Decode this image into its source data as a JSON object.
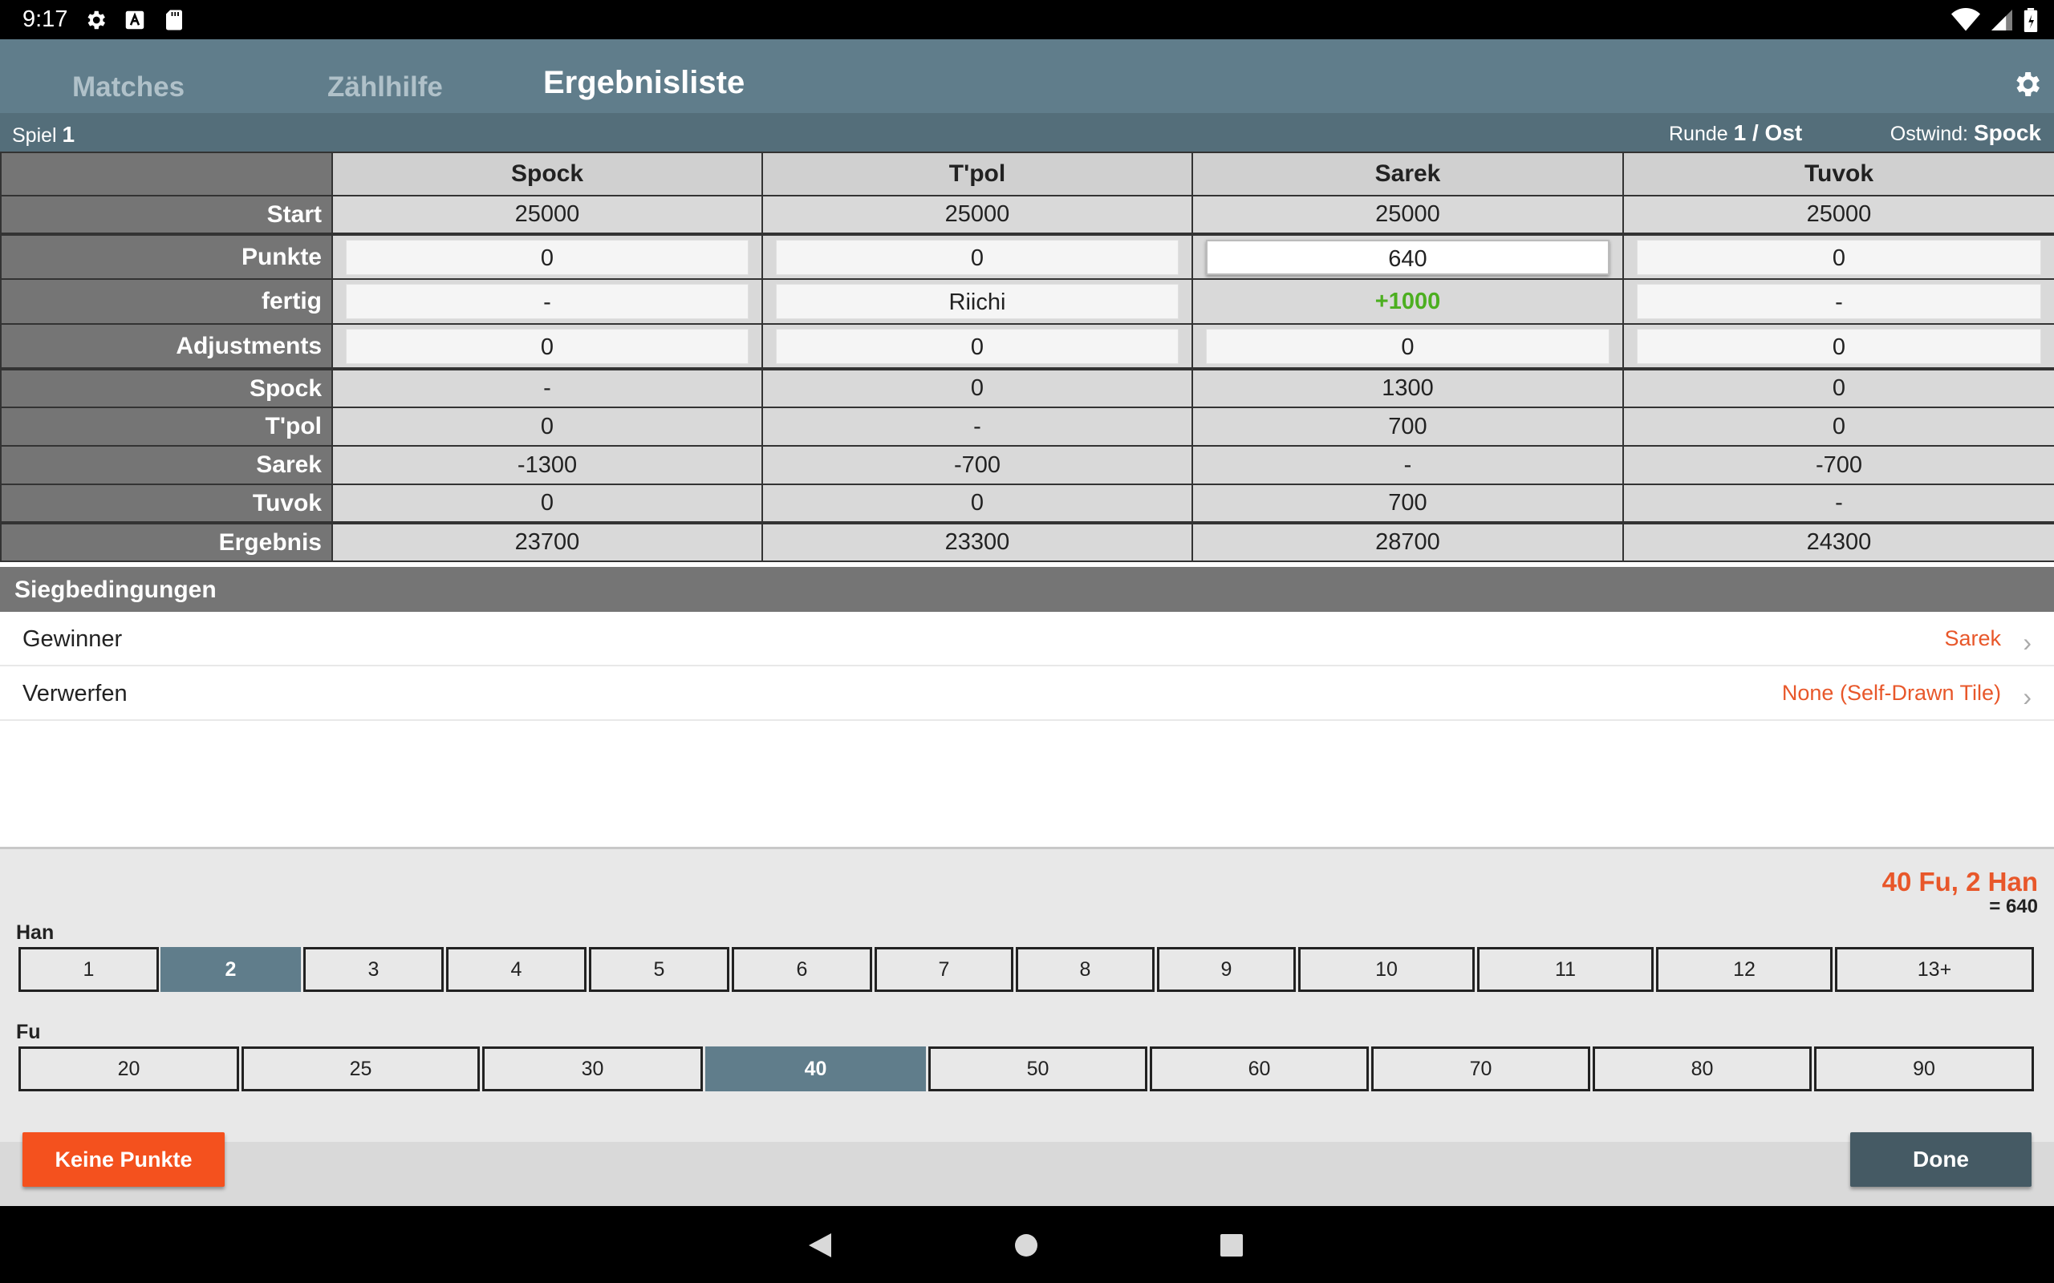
{
  "status": {
    "time": "9:17"
  },
  "tabs": [
    {
      "label": "Matches"
    },
    {
      "label": "Zählhilfe"
    },
    {
      "label": "Ergebnisliste"
    }
  ],
  "info": {
    "spiel_label": "Spiel",
    "spiel_value": "1",
    "runde_label": "Runde",
    "runde_value": "1 / Ost",
    "ostwind_label": "Ostwind:",
    "ostwind_value": "Spock"
  },
  "table": {
    "players": [
      "Spock",
      "T'pol",
      "Sarek",
      "Tuvok"
    ],
    "start": {
      "label": "Start",
      "values": [
        "25000",
        "25000",
        "25000",
        "25000"
      ]
    },
    "punkte": {
      "label": "Punkte",
      "values": [
        "0",
        "0",
        "640",
        "0"
      ]
    },
    "fertig": {
      "label": "fertig",
      "values": [
        "-",
        "Riichi",
        "+1000",
        "-"
      ]
    },
    "adjustments": {
      "label": "Adjustments",
      "values": [
        "0",
        "0",
        "0",
        "0"
      ]
    },
    "transfers": [
      {
        "label": "Spock",
        "values": [
          "-",
          "0",
          "1300",
          "0"
        ]
      },
      {
        "label": "T'pol",
        "values": [
          "0",
          "-",
          "700",
          "0"
        ]
      },
      {
        "label": "Sarek",
        "values": [
          "-1300",
          "-700",
          "-",
          "-700"
        ]
      },
      {
        "label": "Tuvok",
        "values": [
          "0",
          "0",
          "700",
          "-"
        ]
      }
    ],
    "ergebnis": {
      "label": "Ergebnis",
      "values": [
        "23700",
        "23300",
        "28700",
        "24300"
      ]
    }
  },
  "sieg": {
    "header": "Siegbedingungen",
    "gewinner_label": "Gewinner",
    "gewinner_value": "Sarek",
    "verwerfen_label": "Verwerfen",
    "verwerfen_value": "None (Self-Drawn Tile)"
  },
  "scoring": {
    "result": "40 Fu, 2 Han",
    "result_sub": "= 640",
    "han_label": "Han",
    "han_options": [
      "1",
      "2",
      "3",
      "4",
      "5",
      "6",
      "7",
      "8",
      "9",
      "10",
      "11",
      "12",
      "13+"
    ],
    "han_selected": "2",
    "fu_label": "Fu",
    "fu_options": [
      "20",
      "25",
      "30",
      "40",
      "50",
      "60",
      "70",
      "80",
      "90"
    ],
    "fu_selected": "40"
  },
  "buttons": {
    "none_label": "Keine Punkte",
    "done_label": "Done"
  },
  "colors": {
    "accent": "#e8572a",
    "appbar": "#607d8b",
    "selected": "#607d8b",
    "positive": "#4caf20"
  }
}
